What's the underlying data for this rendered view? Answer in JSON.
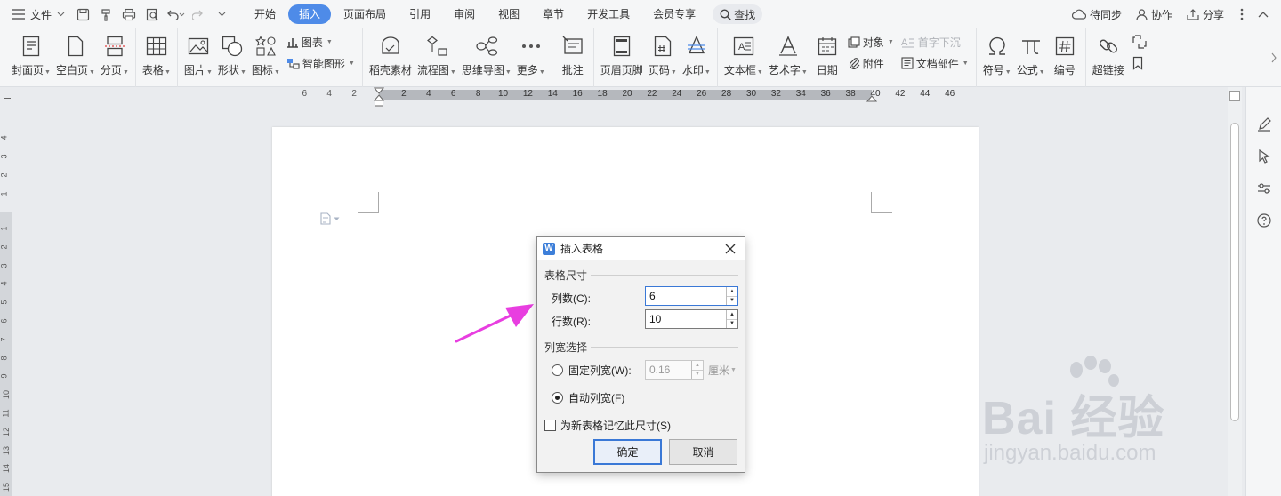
{
  "menubar": {
    "file_label": "文件",
    "tabs": [
      "开始",
      "插入",
      "页面布局",
      "引用",
      "审阅",
      "视图",
      "章节",
      "开发工具",
      "会员专享"
    ],
    "active_tab": "插入",
    "search_label": "查找",
    "right": {
      "sync": "待同步",
      "collab": "协作",
      "share": "分享"
    }
  },
  "ribbon": {
    "cover": "封面页",
    "blank": "空白页",
    "pagebreak": "分页",
    "table": "表格",
    "picture": "图片",
    "shape": "形状",
    "icon": "图标",
    "chart": "图表",
    "smartart": "智能图形",
    "material": "稻壳素材",
    "flowchart": "流程图",
    "mindmap": "思维导图",
    "more": "更多",
    "comment": "批注",
    "headerfooter": "页眉页脚",
    "pagenum": "页码",
    "watermark": "水印",
    "textbox": "文本框",
    "wordart": "艺术字",
    "date": "日期",
    "object": "对象",
    "attachment": "附件",
    "dropcap": "首字下沉",
    "docpart": "文档部件",
    "symbol": "符号",
    "formula": "公式",
    "numbering": "编号",
    "hyperlink": "超链接"
  },
  "ruler": {
    "left_ticks": [
      "6",
      "4",
      "2"
    ],
    "ticks": [
      "2",
      "4",
      "6",
      "8",
      "10",
      "12",
      "14",
      "16",
      "18",
      "20",
      "22",
      "24",
      "26",
      "28",
      "30",
      "32",
      "34",
      "36",
      "38",
      "40",
      "42",
      "44",
      "46"
    ],
    "v_top": [
      "4",
      "3",
      "2",
      "1"
    ],
    "v_ticks": [
      "1",
      "2",
      "3",
      "4",
      "5",
      "6",
      "7",
      "8",
      "9",
      "10",
      "11",
      "12",
      "13",
      "14",
      "15"
    ]
  },
  "dialog": {
    "title": "插入表格",
    "size_section": "表格尺寸",
    "cols_label": "列数(C):",
    "cols_value": "6",
    "rows_label": "行数(R):",
    "rows_value": "10",
    "width_section": "列宽选择",
    "fixed_label": "固定列宽(W):",
    "fixed_value": "0.16",
    "unit": "厘米",
    "auto_label": "自动列宽(F)",
    "remember_label": "为新表格记忆此尺寸(S)",
    "ok": "确定",
    "cancel": "取消"
  },
  "watermark": {
    "main": "Bai 经验",
    "sub": "jingyan.baidu.com"
  },
  "colors": {
    "accent": "#4e8be8",
    "arrow": "#e83ee0"
  }
}
